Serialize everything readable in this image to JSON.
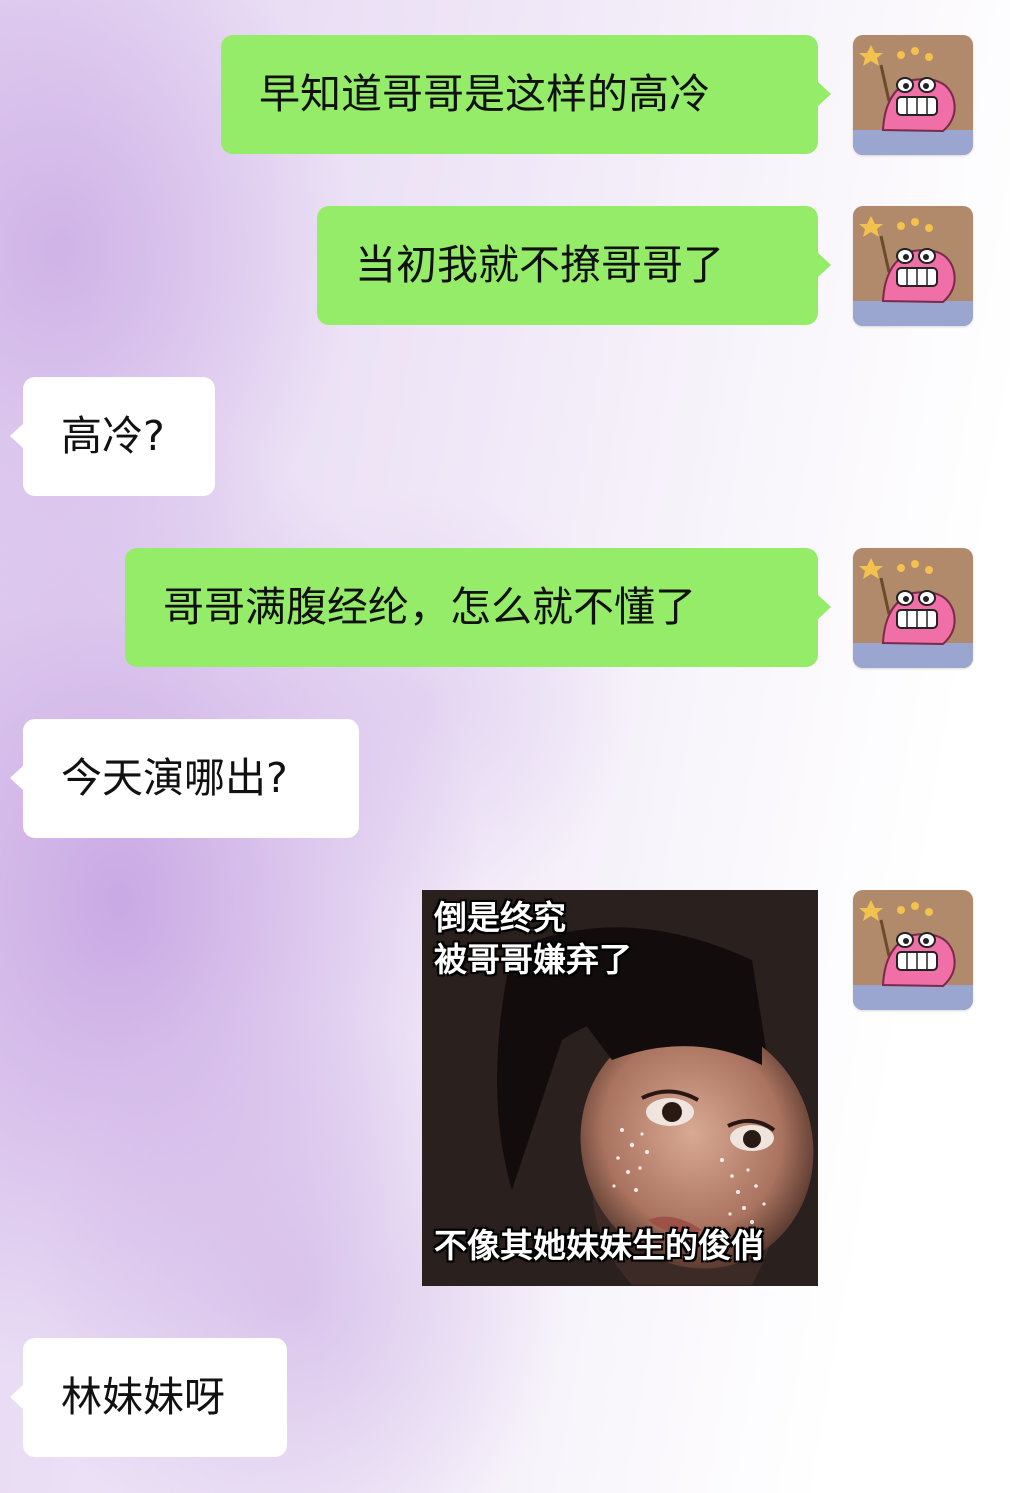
{
  "messages": [
    {
      "direction": "out",
      "type": "text",
      "text": "早知道哥哥是这样的高冷"
    },
    {
      "direction": "out",
      "type": "text",
      "text": "当初我就不撩哥哥了"
    },
    {
      "direction": "in",
      "type": "text",
      "text": "高冷?"
    },
    {
      "direction": "out",
      "type": "text",
      "text": "哥哥满腹经纶，怎么就不懂了"
    },
    {
      "direction": "in",
      "type": "text",
      "text": "今天演哪出?"
    },
    {
      "direction": "out",
      "type": "sticker",
      "caption_top_1": "倒是终究",
      "caption_top_2": "被哥哥嫌弃了",
      "caption_bottom": "不像其她妹妹生的俊俏"
    },
    {
      "direction": "in",
      "type": "text",
      "text": "林妹妹呀"
    }
  ],
  "colors": {
    "outgoing_bubble": "#95ec69",
    "incoming_bubble": "#ffffff",
    "avatar_character": "#ef6fa6"
  },
  "icons": {
    "self_avatar": "pink-crocodile-cartoon-avatar-icon"
  }
}
